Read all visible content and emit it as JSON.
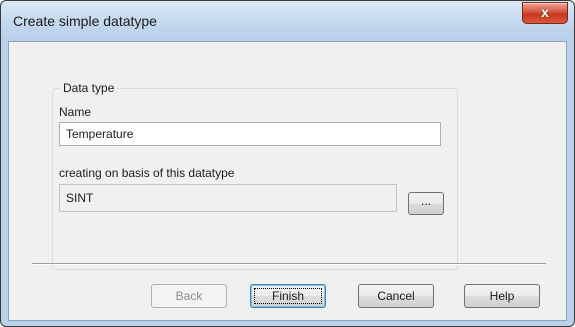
{
  "window": {
    "title": "Create simple datatype",
    "close_label": "x"
  },
  "group": {
    "legend": "Data type",
    "name_label": "Name",
    "name_value": "Temperature",
    "base_label": "creating on basis of this datatype",
    "base_value": "SINT",
    "browse_label": "..."
  },
  "buttons": {
    "back": "Back",
    "finish": "Finish",
    "cancel": "Cancel",
    "help": "Help"
  }
}
